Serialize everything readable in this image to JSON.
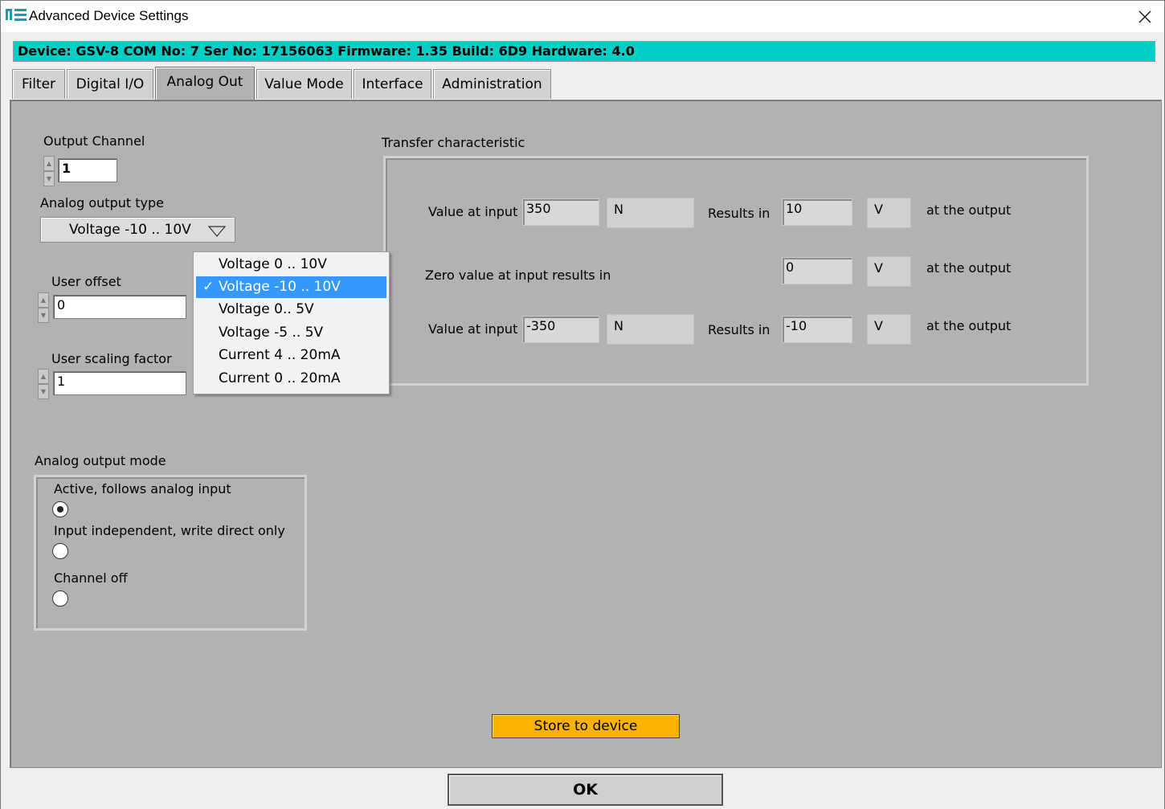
{
  "window": {
    "title": "Advanced Device Settings",
    "close_icon": "close-icon"
  },
  "device_info": "Device: GSV-8 COM No: 7 Ser No: 17156063 Firmware: 1.35 Build: 6D9 Hardware: 4.0",
  "tabs": [
    {
      "label": "Filter",
      "active": false
    },
    {
      "label": "Digital I/O",
      "active": false
    },
    {
      "label": "Analog Out",
      "active": true
    },
    {
      "label": "Value Mode",
      "active": false
    },
    {
      "label": "Interface",
      "active": false
    },
    {
      "label": "Administration",
      "active": false
    }
  ],
  "analog_out": {
    "output_channel": {
      "label": "Output Channel",
      "value": "1"
    },
    "output_type": {
      "label": "Analog output type",
      "selected": "Voltage -10 .. 10V",
      "options": [
        "Voltage 0 .. 10V",
        "Voltage -10 .. 10V",
        "Voltage 0.. 5V",
        "Voltage -5 .. 5V",
        "Current 4 .. 20mA",
        "Current 0 .. 20mA"
      ],
      "selected_index": 1
    },
    "user_offset": {
      "label": "User offset",
      "value": "0"
    },
    "user_scaling": {
      "label": "User scaling factor",
      "value": "1"
    },
    "output_mode": {
      "label": "Analog output mode",
      "options": [
        "Active, follows analog input",
        "Input independent, write direct only",
        "Channel off"
      ],
      "selected_index": 0
    }
  },
  "transfer": {
    "title": "Transfer characteristic",
    "row1": {
      "input_label": "Value at input",
      "input_value": "350",
      "input_unit": "N",
      "results_label": "Results in",
      "result_value": "10",
      "result_unit": "V",
      "suffix": "at the output"
    },
    "row2": {
      "label": "Zero value at input results in",
      "result_value": "0",
      "result_unit": "V",
      "suffix": "at the output"
    },
    "row3": {
      "input_label": "Value at input",
      "input_value": "-350",
      "input_unit": "N",
      "results_label": "Results in",
      "result_value": "-10",
      "result_unit": "V",
      "suffix": "at the output"
    }
  },
  "buttons": {
    "store": "Store to device",
    "ok": "OK"
  },
  "colors": {
    "device_bar": "#00cfc7",
    "panel": "#b2b2b2",
    "store_button": "#f9b200",
    "selection": "#3399ff"
  }
}
